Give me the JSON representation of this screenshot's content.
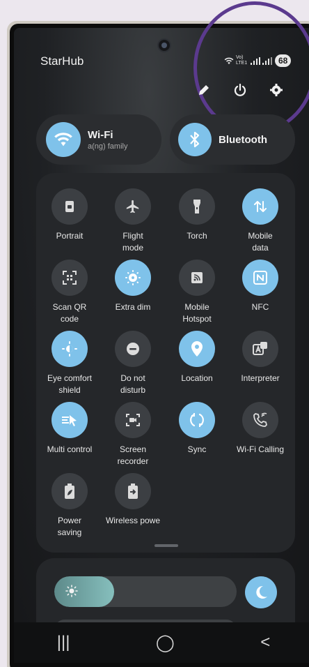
{
  "status_bar": {
    "carrier": "StarHub",
    "network_labels": "Vo) LTE1",
    "battery": "68"
  },
  "quick_actions": {
    "items": [
      {
        "name": "edit",
        "icon": "pencil-icon"
      },
      {
        "name": "power",
        "icon": "power-icon"
      },
      {
        "name": "settings",
        "icon": "gear-icon"
      }
    ]
  },
  "wifi_tile": {
    "title": "Wi-Fi",
    "subtitle": "a(ng) family",
    "icon": "wifi-icon",
    "state": "on"
  },
  "bluetooth_tile": {
    "title": "Bluetooth",
    "icon": "bluetooth-icon",
    "state": "on"
  },
  "tiles": [
    {
      "label": "Portrait",
      "icon": "portrait-lock-icon",
      "on": false
    },
    {
      "label": "Flight\nmode",
      "icon": "airplane-icon",
      "on": false
    },
    {
      "label": "Torch",
      "icon": "flashlight-icon",
      "on": false
    },
    {
      "label": "Mobile\ndata",
      "icon": "mobile-data-icon",
      "on": true
    },
    {
      "label": "Scan QR\ncode",
      "icon": "qr-scan-icon",
      "on": false
    },
    {
      "label": "Extra dim",
      "icon": "extra-dim-icon",
      "on": true
    },
    {
      "label": "Mobile\nHotspot",
      "icon": "hotspot-icon",
      "on": false
    },
    {
      "label": "NFC",
      "icon": "nfc-icon",
      "on": true
    },
    {
      "label": "Eye comfort\nshield",
      "icon": "eye-comfort-icon",
      "on": true
    },
    {
      "label": "Do not\ndisturb",
      "icon": "dnd-icon",
      "on": false
    },
    {
      "label": "Location",
      "icon": "location-pin-icon",
      "on": true
    },
    {
      "label": "Interpreter",
      "icon": "interpreter-icon",
      "on": false
    },
    {
      "label": "Multi control",
      "icon": "multi-control-icon",
      "on": true
    },
    {
      "label": "Screen\nrecorder",
      "icon": "screen-recorder-icon",
      "on": false
    },
    {
      "label": "Sync",
      "icon": "sync-icon",
      "on": true
    },
    {
      "label": "Wi-Fi Calling",
      "icon": "wifi-calling-icon",
      "on": false
    },
    {
      "label": "Power\nsaving",
      "icon": "battery-leaf-icon",
      "on": false
    },
    {
      "label": "Wireless powe",
      "icon": "wireless-power-icon",
      "on": false
    }
  ],
  "brightness": {
    "level": 0.33,
    "icon": "sun-icon"
  },
  "dark_mode": {
    "icon": "moon-icon",
    "state": "on"
  },
  "nav_bar": {
    "recents": "|||",
    "home": "◯",
    "back": "<"
  },
  "colors": {
    "accent": "#7fc2ea",
    "tile_off": "#3c3f43",
    "panel": "#25272a",
    "highlight_ring": "#5b3a8e"
  }
}
